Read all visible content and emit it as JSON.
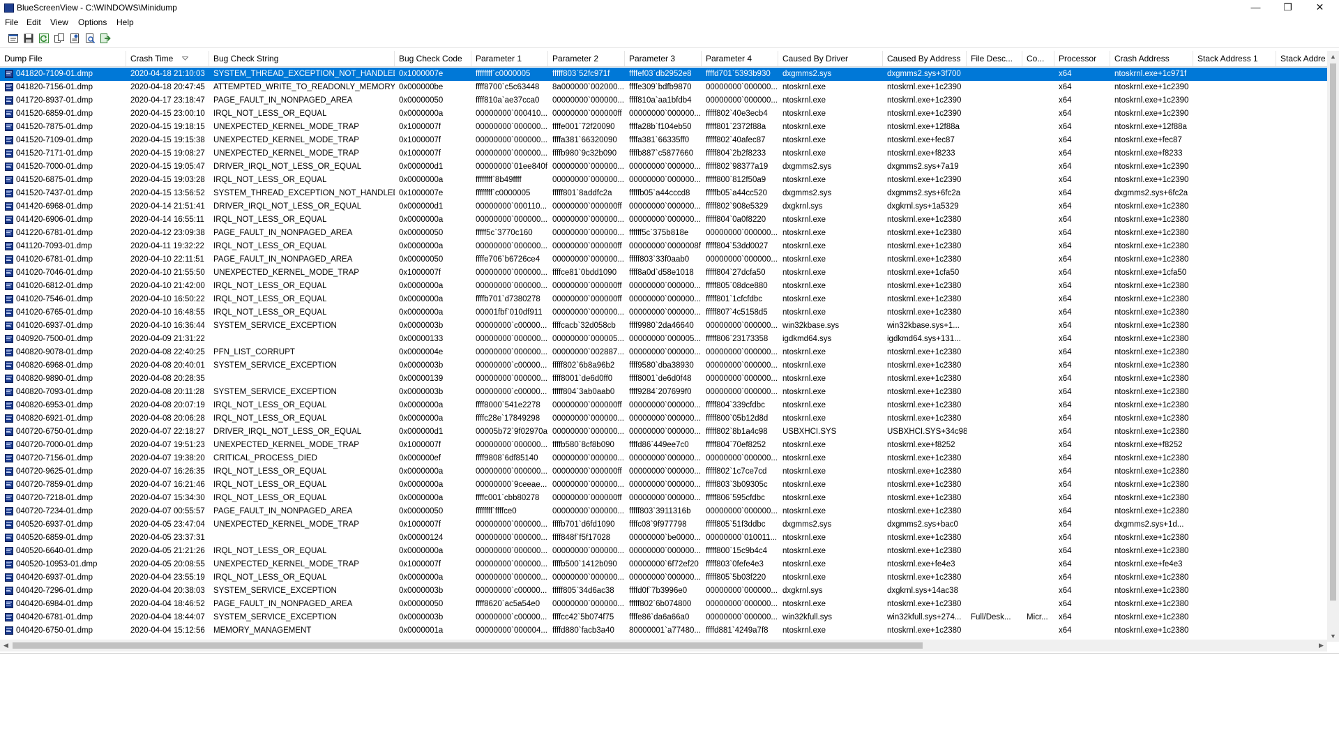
{
  "window": {
    "title": "BlueScreenView  -  C:\\WINDOWS\\Minidump",
    "controls": {
      "minimize": "—",
      "restore": "❐",
      "close": "✕"
    }
  },
  "menu": [
    "File",
    "Edit",
    "View",
    "Options",
    "Help"
  ],
  "toolbar": [
    "properties-icon",
    "save-icon",
    "refresh-icon",
    "copy-icon",
    "html-report-icon",
    "find-icon",
    "exit-icon"
  ],
  "columns": [
    "Dump File",
    "Crash Time",
    "Bug Check String",
    "Bug Check Code",
    "Parameter 1",
    "Parameter 2",
    "Parameter 3",
    "Parameter 4",
    "Caused By Driver",
    "Caused By Address",
    "File Desc...",
    "Co...",
    "Processor",
    "Crash Address",
    "Stack Address 1",
    "Stack Addre"
  ],
  "rows": [
    [
      "041820-7109-01.dmp",
      "2020-04-18 21:10:03",
      "SYSTEM_THREAD_EXCEPTION_NOT_HANDLED",
      "0x1000007e",
      "ffffffff`c0000005",
      "fffff803`52fc971f",
      "ffffef03`db2952e8",
      "ffffd701`5393b930",
      "dxgmms2.sys",
      "dxgmms2.sys+3f700",
      "",
      "",
      "x64",
      "ntoskrnl.exe+1c971f",
      "",
      ""
    ],
    [
      "041820-7156-01.dmp",
      "2020-04-18 20:47:45",
      "ATTEMPTED_WRITE_TO_READONLY_MEMORY",
      "0x000000be",
      "ffff8700`c5c63448",
      "8a000000`002000...",
      "ffffe309`bdfb9870",
      "00000000`000000...",
      "ntoskrnl.exe",
      "ntoskrnl.exe+1c2390",
      "",
      "",
      "x64",
      "ntoskrnl.exe+1c2390",
      "",
      ""
    ],
    [
      "041720-8937-01.dmp",
      "2020-04-17 23:18:47",
      "PAGE_FAULT_IN_NONPAGED_AREA",
      "0x00000050",
      "ffff810a`ae37cca0",
      "00000000`000000...",
      "ffff810a`aa1bfdb4",
      "00000000`000000...",
      "ntoskrnl.exe",
      "ntoskrnl.exe+1c2390",
      "",
      "",
      "x64",
      "ntoskrnl.exe+1c2390",
      "",
      ""
    ],
    [
      "041520-6859-01.dmp",
      "2020-04-15 23:00:10",
      "IRQL_NOT_LESS_OR_EQUAL",
      "0x0000000a",
      "00000000`000410...",
      "00000000`000000ff",
      "00000000`000000...",
      "fffff802`40e3ecb4",
      "ntoskrnl.exe",
      "ntoskrnl.exe+1c2390",
      "",
      "",
      "x64",
      "ntoskrnl.exe+1c2390",
      "",
      ""
    ],
    [
      "041520-7875-01.dmp",
      "2020-04-15 19:18:15",
      "UNEXPECTED_KERNEL_MODE_TRAP",
      "0x1000007f",
      "00000000`000000...",
      "ffffe001`72f20090",
      "ffffa28b`f104eb50",
      "fffff801`2372f88a",
      "ntoskrnl.exe",
      "ntoskrnl.exe+12f88a",
      "",
      "",
      "x64",
      "ntoskrnl.exe+12f88a",
      "",
      ""
    ],
    [
      "041520-7109-01.dmp",
      "2020-04-15 19:15:38",
      "UNEXPECTED_KERNEL_MODE_TRAP",
      "0x1000007f",
      "00000000`000000...",
      "ffffa381`66320090",
      "ffffa381`66335ff0",
      "fffff802`40afec87",
      "ntoskrnl.exe",
      "ntoskrnl.exe+fec87",
      "",
      "",
      "x64",
      "ntoskrnl.exe+fec87",
      "",
      ""
    ],
    [
      "041520-7171-01.dmp",
      "2020-04-15 19:08:27",
      "UNEXPECTED_KERNEL_MODE_TRAP",
      "0x1000007f",
      "00000000`000000...",
      "ffffb980`9c32b090",
      "ffffb887`c5877660",
      "fffff804`2b2f8233",
      "ntoskrnl.exe",
      "ntoskrnl.exe+f8233",
      "",
      "",
      "x64",
      "ntoskrnl.exe+f8233",
      "",
      ""
    ],
    [
      "041520-7000-01.dmp",
      "2020-04-15 19:05:47",
      "DRIVER_IRQL_NOT_LESS_OR_EQUAL",
      "0x000000d1",
      "00000000`01ee840f",
      "00000000`000000...",
      "00000000`000000...",
      "fffff802`98377a19",
      "dxgmms2.sys",
      "dxgmms2.sys+7a19",
      "",
      "",
      "x64",
      "ntoskrnl.exe+1c2390",
      "",
      ""
    ],
    [
      "041520-6875-01.dmp",
      "2020-04-15 19:03:28",
      "IRQL_NOT_LESS_OR_EQUAL",
      "0x0000000a",
      "ffffffff`8b49ffff",
      "00000000`000000...",
      "00000000`000000...",
      "fffff800`812f50a9",
      "ntoskrnl.exe",
      "ntoskrnl.exe+1c2390",
      "",
      "",
      "x64",
      "ntoskrnl.exe+1c2390",
      "",
      ""
    ],
    [
      "041520-7437-01.dmp",
      "2020-04-15 13:56:52",
      "SYSTEM_THREAD_EXCEPTION_NOT_HANDLED",
      "0x1000007e",
      "ffffffff`c0000005",
      "fffff801`8addfc2a",
      "fffffb05`a44cccd8",
      "fffffb05`a44cc520",
      "dxgmms2.sys",
      "dxgmms2.sys+6fc2a",
      "",
      "",
      "x64",
      "dxgmms2.sys+6fc2a",
      "",
      ""
    ],
    [
      "041420-6968-01.dmp",
      "2020-04-14 21:51:41",
      "DRIVER_IRQL_NOT_LESS_OR_EQUAL",
      "0x000000d1",
      "00000000`000110...",
      "00000000`000000ff",
      "00000000`000000...",
      "fffff802`908e5329",
      "dxgkrnl.sys",
      "dxgkrnl.sys+1a5329",
      "",
      "",
      "x64",
      "ntoskrnl.exe+1c2380",
      "",
      ""
    ],
    [
      "041420-6906-01.dmp",
      "2020-04-14 16:55:11",
      "IRQL_NOT_LESS_OR_EQUAL",
      "0x0000000a",
      "00000000`000000...",
      "00000000`000000...",
      "00000000`000000...",
      "fffff804`0a0f8220",
      "ntoskrnl.exe",
      "ntoskrnl.exe+1c2380",
      "",
      "",
      "x64",
      "ntoskrnl.exe+1c2380",
      "",
      ""
    ],
    [
      "041220-6781-01.dmp",
      "2020-04-12 23:09:38",
      "PAGE_FAULT_IN_NONPAGED_AREA",
      "0x00000050",
      "fffff5c`3770c160",
      "00000000`000000...",
      "ffffff5c`375b818e",
      "00000000`000000...",
      "ntoskrnl.exe",
      "ntoskrnl.exe+1c2380",
      "",
      "",
      "x64",
      "ntoskrnl.exe+1c2380",
      "",
      ""
    ],
    [
      "041120-7093-01.dmp",
      "2020-04-11 19:32:22",
      "IRQL_NOT_LESS_OR_EQUAL",
      "0x0000000a",
      "00000000`000000...",
      "00000000`000000ff",
      "00000000`0000008f",
      "fffff804`53dd0027",
      "ntoskrnl.exe",
      "ntoskrnl.exe+1c2380",
      "",
      "",
      "x64",
      "ntoskrnl.exe+1c2380",
      "",
      ""
    ],
    [
      "041020-6781-01.dmp",
      "2020-04-10 22:11:51",
      "PAGE_FAULT_IN_NONPAGED_AREA",
      "0x00000050",
      "ffffe706`b6726ce4",
      "00000000`000000...",
      "fffff803`33f0aab0",
      "00000000`000000...",
      "ntoskrnl.exe",
      "ntoskrnl.exe+1c2380",
      "",
      "",
      "x64",
      "ntoskrnl.exe+1c2380",
      "",
      ""
    ],
    [
      "041020-7046-01.dmp",
      "2020-04-10 21:55:50",
      "UNEXPECTED_KERNEL_MODE_TRAP",
      "0x1000007f",
      "00000000`000000...",
      "ffffce81`0bdd1090",
      "ffff8a0d`d58e1018",
      "fffff804`27dcfa50",
      "ntoskrnl.exe",
      "ntoskrnl.exe+1cfa50",
      "",
      "",
      "x64",
      "ntoskrnl.exe+1cfa50",
      "",
      ""
    ],
    [
      "041020-6812-01.dmp",
      "2020-04-10 21:42:00",
      "IRQL_NOT_LESS_OR_EQUAL",
      "0x0000000a",
      "00000000`000000...",
      "00000000`000000ff",
      "00000000`000000...",
      "fffff805`08dce880",
      "ntoskrnl.exe",
      "ntoskrnl.exe+1c2380",
      "",
      "",
      "x64",
      "ntoskrnl.exe+1c2380",
      "",
      ""
    ],
    [
      "041020-7546-01.dmp",
      "2020-04-10 16:50:22",
      "IRQL_NOT_LESS_OR_EQUAL",
      "0x0000000a",
      "ffffb701`d7380278",
      "00000000`000000ff",
      "00000000`000000...",
      "fffff801`1cfcfdbc",
      "ntoskrnl.exe",
      "ntoskrnl.exe+1c2380",
      "",
      "",
      "x64",
      "ntoskrnl.exe+1c2380",
      "",
      ""
    ],
    [
      "041020-6765-01.dmp",
      "2020-04-10 16:48:55",
      "IRQL_NOT_LESS_OR_EQUAL",
      "0x0000000a",
      "00001fbf`010df911",
      "00000000`000000...",
      "00000000`000000...",
      "fffff807`4c5158d5",
      "ntoskrnl.exe",
      "ntoskrnl.exe+1c2380",
      "",
      "",
      "x64",
      "ntoskrnl.exe+1c2380",
      "",
      ""
    ],
    [
      "041020-6937-01.dmp",
      "2020-04-10 16:36:44",
      "SYSTEM_SERVICE_EXCEPTION",
      "0x0000003b",
      "00000000`c00000...",
      "ffffcacb`32d058cb",
      "ffff9980`2da46640",
      "00000000`000000...",
      "win32kbase.sys",
      "win32kbase.sys+1...",
      "",
      "",
      "x64",
      "ntoskrnl.exe+1c2380",
      "",
      ""
    ],
    [
      "040920-7500-01.dmp",
      "2020-04-09 21:31:22",
      "",
      "0x00000133",
      "00000000`000000...",
      "00000000`000005...",
      "00000000`000005...",
      "fffff806`23173358",
      "igdkmd64.sys",
      "igdkmd64.sys+131...",
      "",
      "",
      "x64",
      "ntoskrnl.exe+1c2380",
      "",
      ""
    ],
    [
      "040820-9078-01.dmp",
      "2020-04-08 22:40:25",
      "PFN_LIST_CORRUPT",
      "0x0000004e",
      "00000000`000000...",
      "00000000`002887...",
      "00000000`000000...",
      "00000000`000000...",
      "ntoskrnl.exe",
      "ntoskrnl.exe+1c2380",
      "",
      "",
      "x64",
      "ntoskrnl.exe+1c2380",
      "",
      ""
    ],
    [
      "040820-6968-01.dmp",
      "2020-04-08 20:40:01",
      "SYSTEM_SERVICE_EXCEPTION",
      "0x0000003b",
      "00000000`c00000...",
      "fffff802`6b8a96b2",
      "ffff9580`dba38930",
      "00000000`000000...",
      "ntoskrnl.exe",
      "ntoskrnl.exe+1c2380",
      "",
      "",
      "x64",
      "ntoskrnl.exe+1c2380",
      "",
      ""
    ],
    [
      "040820-9890-01.dmp",
      "2020-04-08 20:28:35",
      "",
      "0x00000139",
      "00000000`000000...",
      "ffff8001`de6d0ff0",
      "ffff8001`de6d0f48",
      "00000000`000000...",
      "ntoskrnl.exe",
      "ntoskrnl.exe+1c2380",
      "",
      "",
      "x64",
      "ntoskrnl.exe+1c2380",
      "",
      ""
    ],
    [
      "040820-7093-01.dmp",
      "2020-04-08 20:11:28",
      "SYSTEM_SERVICE_EXCEPTION",
      "0x0000003b",
      "00000000`c00000...",
      "fffff804`3ab0aab0",
      "ffff9284`207699f0",
      "00000000`000000...",
      "ntoskrnl.exe",
      "ntoskrnl.exe+1c2380",
      "",
      "",
      "x64",
      "ntoskrnl.exe+1c2380",
      "",
      ""
    ],
    [
      "040820-6953-01.dmp",
      "2020-04-08 20:07:19",
      "IRQL_NOT_LESS_OR_EQUAL",
      "0x0000000a",
      "ffff8000`541e2278",
      "00000000`000000ff",
      "00000000`000000...",
      "fffff804`339cfdbc",
      "ntoskrnl.exe",
      "ntoskrnl.exe+1c2380",
      "",
      "",
      "x64",
      "ntoskrnl.exe+1c2380",
      "",
      ""
    ],
    [
      "040820-6921-01.dmp",
      "2020-04-08 20:06:28",
      "IRQL_NOT_LESS_OR_EQUAL",
      "0x0000000a",
      "ffffc28e`17849298",
      "00000000`000000...",
      "00000000`000000...",
      "fffff800`05b12d8d",
      "ntoskrnl.exe",
      "ntoskrnl.exe+1c2380",
      "",
      "",
      "x64",
      "ntoskrnl.exe+1c2380",
      "",
      ""
    ],
    [
      "040720-6750-01.dmp",
      "2020-04-07 22:18:27",
      "DRIVER_IRQL_NOT_LESS_OR_EQUAL",
      "0x000000d1",
      "00005b72`9f02970a",
      "00000000`000000...",
      "00000000`000000...",
      "fffff802`8b1a4c98",
      "USBXHCI.SYS",
      "USBXHCI.SYS+34c98",
      "",
      "",
      "x64",
      "ntoskrnl.exe+1c2380",
      "",
      ""
    ],
    [
      "040720-7000-01.dmp",
      "2020-04-07 19:51:23",
      "UNEXPECTED_KERNEL_MODE_TRAP",
      "0x1000007f",
      "00000000`000000...",
      "ffffb580`8cf8b090",
      "ffffd86`449ee7c0",
      "fffff804`70ef8252",
      "ntoskrnl.exe",
      "ntoskrnl.exe+f8252",
      "",
      "",
      "x64",
      "ntoskrnl.exe+f8252",
      "",
      ""
    ],
    [
      "040720-7156-01.dmp",
      "2020-04-07 19:38:20",
      "CRITICAL_PROCESS_DIED",
      "0x000000ef",
      "ffff9808`6df85140",
      "00000000`000000...",
      "00000000`000000...",
      "00000000`000000...",
      "ntoskrnl.exe",
      "ntoskrnl.exe+1c2380",
      "",
      "",
      "x64",
      "ntoskrnl.exe+1c2380",
      "",
      ""
    ],
    [
      "040720-9625-01.dmp",
      "2020-04-07 16:26:35",
      "IRQL_NOT_LESS_OR_EQUAL",
      "0x0000000a",
      "00000000`000000...",
      "00000000`000000ff",
      "00000000`000000...",
      "fffff802`1c7ce7cd",
      "ntoskrnl.exe",
      "ntoskrnl.exe+1c2380",
      "",
      "",
      "x64",
      "ntoskrnl.exe+1c2380",
      "",
      ""
    ],
    [
      "040720-7859-01.dmp",
      "2020-04-07 16:21:46",
      "IRQL_NOT_LESS_OR_EQUAL",
      "0x0000000a",
      "00000000`9ceeae...",
      "00000000`000000...",
      "00000000`000000...",
      "fffff803`3b09305c",
      "ntoskrnl.exe",
      "ntoskrnl.exe+1c2380",
      "",
      "",
      "x64",
      "ntoskrnl.exe+1c2380",
      "",
      ""
    ],
    [
      "040720-7218-01.dmp",
      "2020-04-07 15:34:30",
      "IRQL_NOT_LESS_OR_EQUAL",
      "0x0000000a",
      "ffffc001`cbb80278",
      "00000000`000000ff",
      "00000000`000000...",
      "fffff806`595cfdbc",
      "ntoskrnl.exe",
      "ntoskrnl.exe+1c2380",
      "",
      "",
      "x64",
      "ntoskrnl.exe+1c2380",
      "",
      ""
    ],
    [
      "040720-7234-01.dmp",
      "2020-04-07 00:55:57",
      "PAGE_FAULT_IN_NONPAGED_AREA",
      "0x00000050",
      "ffffffff`ffffce0",
      "00000000`000000...",
      "fffff803`3911316b",
      "00000000`000000...",
      "ntoskrnl.exe",
      "ntoskrnl.exe+1c2380",
      "",
      "",
      "x64",
      "ntoskrnl.exe+1c2380",
      "",
      ""
    ],
    [
      "040520-6937-01.dmp",
      "2020-04-05 23:47:04",
      "UNEXPECTED_KERNEL_MODE_TRAP",
      "0x1000007f",
      "00000000`000000...",
      "ffffb701`d6fd1090",
      "ffffc08`9f977798",
      "fffff805`51f3ddbc",
      "dxgmms2.sys",
      "dxgmms2.sys+bac0",
      "",
      "",
      "x64",
      "dxgmms2.sys+1d...",
      "",
      ""
    ],
    [
      "040520-6859-01.dmp",
      "2020-04-05 23:37:31",
      "",
      "0x00000124",
      "00000000`000000...",
      "ffff848f`f5f17028",
      "00000000`be0000...",
      "00000000`010011...",
      "ntoskrnl.exe",
      "ntoskrnl.exe+1c2380",
      "",
      "",
      "x64",
      "ntoskrnl.exe+1c2380",
      "",
      ""
    ],
    [
      "040520-6640-01.dmp",
      "2020-04-05 21:21:26",
      "IRQL_NOT_LESS_OR_EQUAL",
      "0x0000000a",
      "00000000`000000...",
      "00000000`000000...",
      "00000000`000000...",
      "fffff800`15c9b4c4",
      "ntoskrnl.exe",
      "ntoskrnl.exe+1c2380",
      "",
      "",
      "x64",
      "ntoskrnl.exe+1c2380",
      "",
      ""
    ],
    [
      "040520-10953-01.dmp",
      "2020-04-05 20:08:55",
      "UNEXPECTED_KERNEL_MODE_TRAP",
      "0x1000007f",
      "00000000`000000...",
      "ffffb500`1412b090",
      "00000000`6f72ef20",
      "fffff803`0fefe4e3",
      "ntoskrnl.exe",
      "ntoskrnl.exe+fe4e3",
      "",
      "",
      "x64",
      "ntoskrnl.exe+fe4e3",
      "",
      ""
    ],
    [
      "040420-6937-01.dmp",
      "2020-04-04 23:55:19",
      "IRQL_NOT_LESS_OR_EQUAL",
      "0x0000000a",
      "00000000`000000...",
      "00000000`000000...",
      "00000000`000000...",
      "fffff805`5b03f220",
      "ntoskrnl.exe",
      "ntoskrnl.exe+1c2380",
      "",
      "",
      "x64",
      "ntoskrnl.exe+1c2380",
      "",
      ""
    ],
    [
      "040420-7296-01.dmp",
      "2020-04-04 20:38:03",
      "SYSTEM_SERVICE_EXCEPTION",
      "0x0000003b",
      "00000000`c00000...",
      "fffff805`34d6ac38",
      "ffffd0f`7b3996e0",
      "00000000`000000...",
      "dxgkrnl.sys",
      "dxgkrnl.sys+14ac38",
      "",
      "",
      "x64",
      "ntoskrnl.exe+1c2380",
      "",
      ""
    ],
    [
      "040420-6984-01.dmp",
      "2020-04-04 18:46:52",
      "PAGE_FAULT_IN_NONPAGED_AREA",
      "0x00000050",
      "ffff8620`ac5a54e0",
      "00000000`000000...",
      "fffff802`6b074800",
      "00000000`000000...",
      "ntoskrnl.exe",
      "ntoskrnl.exe+1c2380",
      "",
      "",
      "x64",
      "ntoskrnl.exe+1c2380",
      "",
      ""
    ],
    [
      "040420-6781-01.dmp",
      "2020-04-04 18:44:07",
      "SYSTEM_SERVICE_EXCEPTION",
      "0x0000003b",
      "00000000`c00000...",
      "ffffcc42`5b074f75",
      "ffffe86`da6a66a0",
      "00000000`000000...",
      "win32kfull.sys",
      "win32kfull.sys+274...",
      "Full/Desk...",
      "Micr...",
      "x64",
      "ntoskrnl.exe+1c2380",
      "",
      ""
    ],
    [
      "040420-6750-01.dmp",
      "2020-04-04 15:12:56",
      "MEMORY_MANAGEMENT",
      "0x0000001a",
      "00000000`000004...",
      "ffffd880`facb3a40",
      "80000001`a77480...",
      "ffffd881`4249a7f8",
      "ntoskrnl.exe",
      "ntoskrnl.exe+1c2380",
      "",
      "",
      "x64",
      "ntoskrnl.exe+1c2380",
      "",
      ""
    ]
  ],
  "selected_row": 0,
  "sort": {
    "column": "Crash Time",
    "direction": "descending"
  },
  "colors": {
    "selection": "#0078d7",
    "scrollbar_track": "#f0f0f0",
    "scrollbar_thumb": "#c1c1c1"
  }
}
